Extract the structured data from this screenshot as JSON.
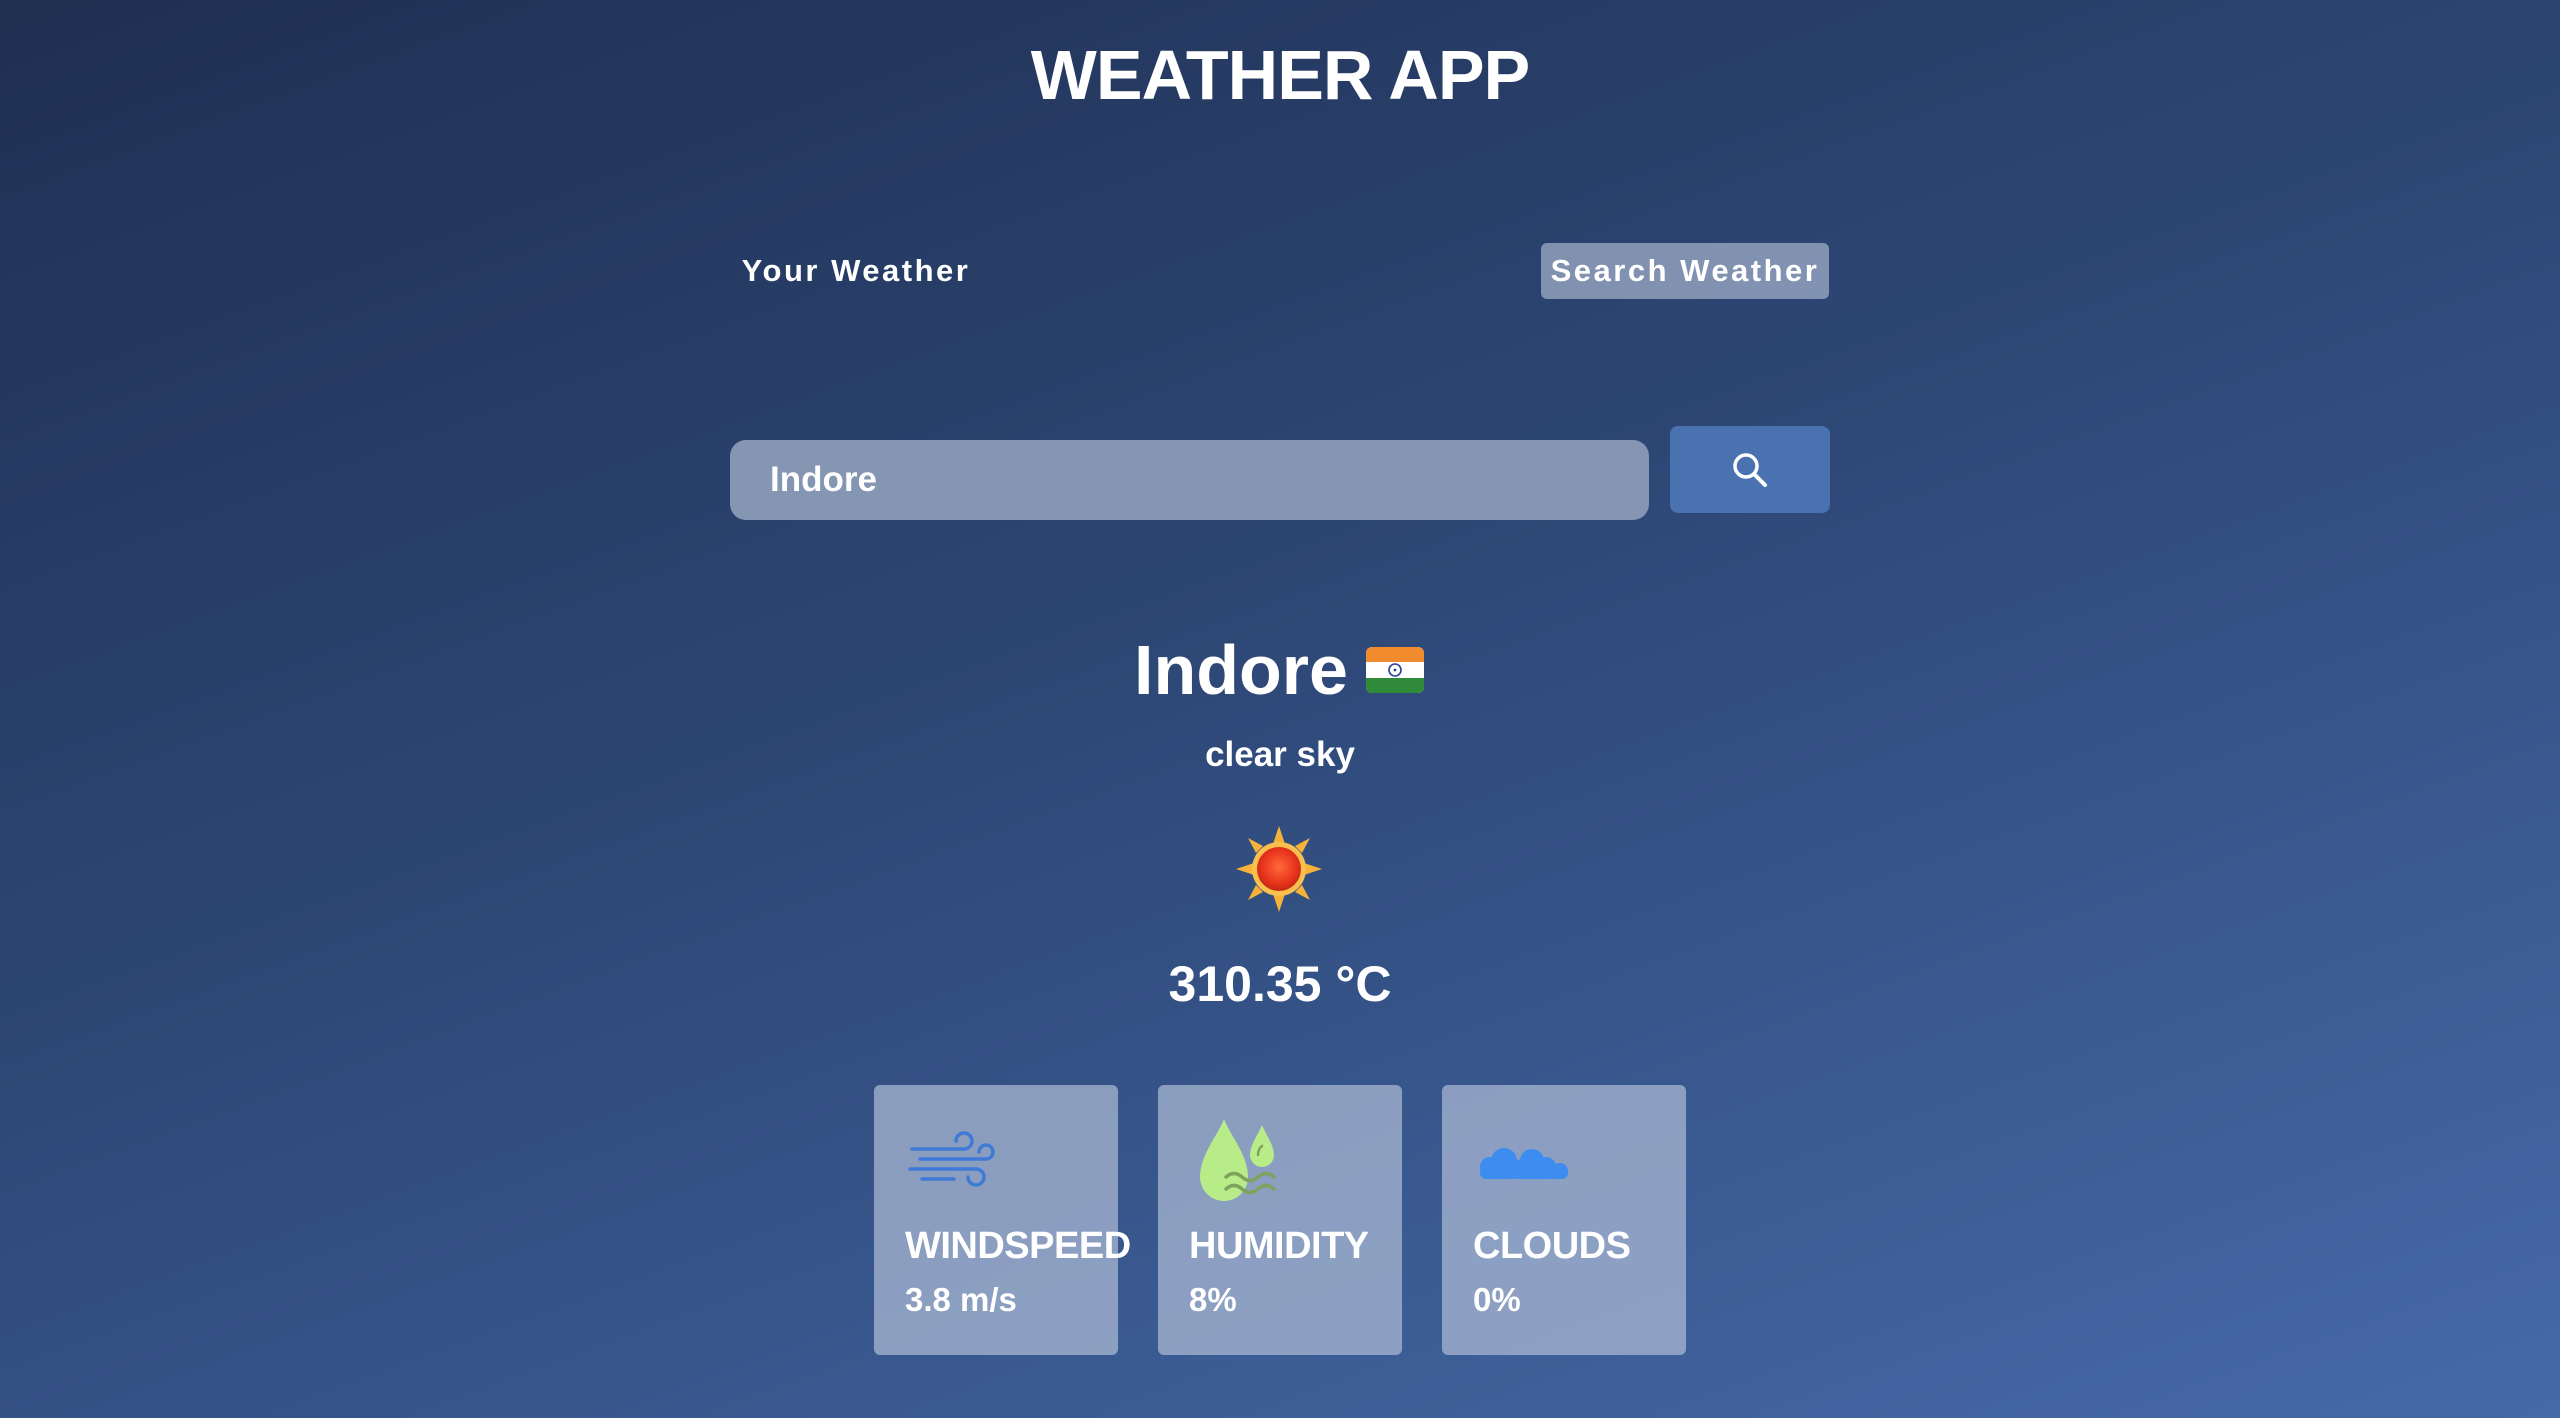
{
  "app": {
    "title": "WEATHER APP"
  },
  "tabs": {
    "your_weather": "Your Weather",
    "search_weather": "Search Weather",
    "active": "search_weather"
  },
  "search": {
    "value": "Indore",
    "button_icon": "search-icon"
  },
  "current": {
    "city": "Indore",
    "country_flag_icon": "india-flag-icon",
    "description": "clear sky",
    "weather_icon": "sun-icon",
    "temperature": "310.35 °C"
  },
  "cards": [
    {
      "icon": "wind-icon",
      "label": "WINDSPEED",
      "value": "3.8 m/s"
    },
    {
      "icon": "humidity-icon",
      "label": "HUMIDITY",
      "value": "8%"
    },
    {
      "icon": "clouds-icon",
      "label": "CLOUDS",
      "value": "0%"
    }
  ],
  "colors": {
    "background_start": "#1f2f52",
    "background_end": "#4769a8",
    "search_button": "#4a72b0",
    "input_background": "#8596b2",
    "wind_icon": "#3f7bd6",
    "humidity_icon": "#b8ec88",
    "clouds_icon": "#3d8cf0"
  }
}
